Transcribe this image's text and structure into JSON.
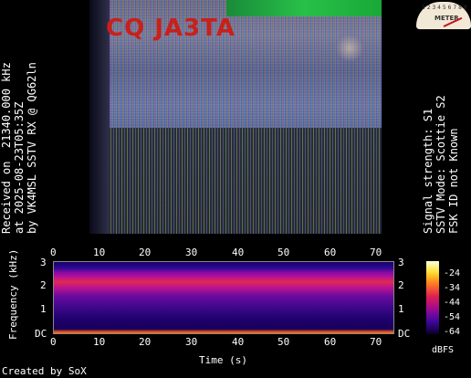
{
  "received_info": {
    "line1": "Received on  21340.000 kHz",
    "line2": "at 2025-08-23T05:35Z",
    "line3": "by VK4MSL SSTV RX @ QG62ln"
  },
  "signal_info": {
    "line1": "Signal strength: S1",
    "line2": "SSTV Mode: Scottie S2",
    "line3": "FSK ID not Known"
  },
  "sstv_image": {
    "logo_text": "CQ JA3TA"
  },
  "meter": {
    "scale_text": "1 2 3 4 5 6 7 8 9",
    "label": "METER"
  },
  "spectrogram": {
    "x_ticks": [
      "0",
      "10",
      "20",
      "30",
      "40",
      "50",
      "60",
      "70"
    ],
    "y_ticks_left": [
      "3",
      "2",
      "1",
      "DC"
    ],
    "y_ticks_right": [
      "3",
      "2",
      "1",
      "DC"
    ],
    "xlabel": "Time (s)",
    "ylabel": "Frequency (kHz)"
  },
  "colorbar": {
    "ticks": [
      "-24",
      "-34",
      "-44",
      "-54",
      "-64"
    ],
    "unit": "dBFS"
  },
  "footer": {
    "credit": "Created by SoX"
  },
  "colors": {
    "background": "#000000",
    "text": "#ffffff"
  }
}
